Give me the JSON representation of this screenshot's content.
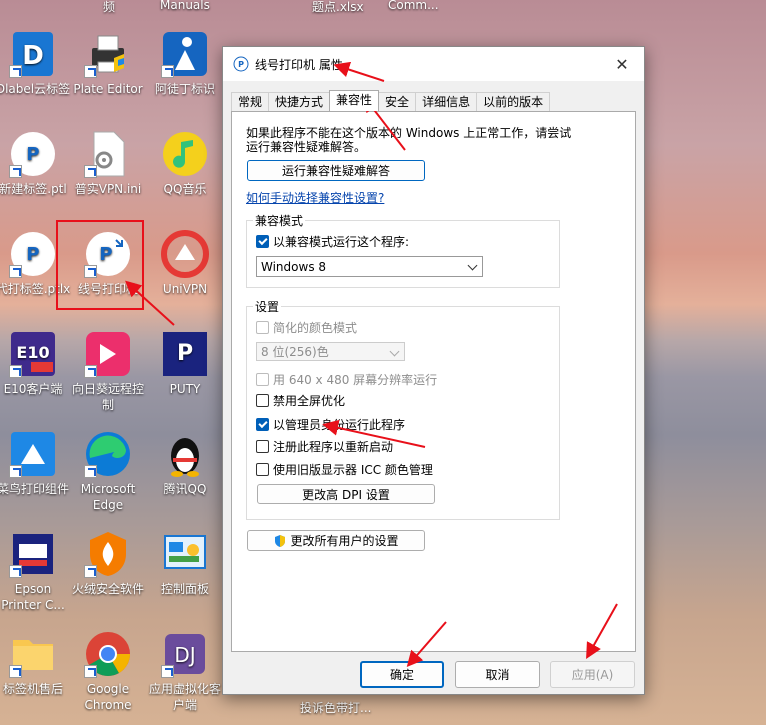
{
  "desktop": {
    "top_captions": [
      "频",
      "Manuals",
      "题点.xlsx",
      "Comm..."
    ],
    "icons": [
      {
        "label": "Dlabel云标签",
        "icon": "dlabel-app-icon"
      },
      {
        "label": "Plate Editor",
        "icon": "printer-app-icon"
      },
      {
        "label": "阿徒丁标识",
        "icon": "atu-app-icon"
      },
      {
        "label": "新建标签.ptl",
        "icon": "puty-file-icon"
      },
      {
        "label": "普实VPN.ini",
        "icon": "settings-file-icon"
      },
      {
        "label": "QQ音乐",
        "icon": "qq-music-icon"
      },
      {
        "label": "代打标签.ptlx",
        "icon": "puty-file-icon"
      },
      {
        "label": "线号打印机",
        "icon": "puty-app-icon"
      },
      {
        "label": "UniVPN",
        "icon": "univpn-icon"
      },
      {
        "label": "E10客户端",
        "icon": "e10-app-icon"
      },
      {
        "label": "向日葵远程控制",
        "icon": "sunlogin-icon"
      },
      {
        "label": "PUTY",
        "icon": "puty-logo-icon"
      },
      {
        "label": "菜鸟打印组件",
        "icon": "cainiao-icon"
      },
      {
        "label": "Microsoft Edge",
        "icon": "edge-icon"
      },
      {
        "label": "腾讯QQ",
        "icon": "qq-penguin-icon"
      },
      {
        "label": "Epson Printer C...",
        "icon": "epson-icon"
      },
      {
        "label": "火绒安全软件",
        "icon": "huorong-icon"
      },
      {
        "label": "控制面板",
        "icon": "control-panel-icon"
      },
      {
        "label": "标签机售后",
        "icon": "folder-icon"
      },
      {
        "label": "Google Chrome",
        "icon": "chrome-icon"
      },
      {
        "label": "应用虚拟化客户端",
        "icon": "virtual-app-icon"
      }
    ],
    "bottom_caption": "投诉色带打..."
  },
  "dialog": {
    "title": "线号打印机 属性",
    "close_glyph": "✕",
    "tabs": [
      "常规",
      "快捷方式",
      "兼容性",
      "安全",
      "详细信息",
      "以前的版本"
    ],
    "active_tab": 2,
    "intro_line1": "如果此程序不能在这个版本的 Windows 上正常工作，请尝试",
    "intro_line2": "运行兼容性疑难解答。",
    "troubleshoot_button": "运行兼容性疑难解答",
    "manual_link": "如何手动选择兼容性设置?",
    "compat_group_label": "兼容模式",
    "compat_checkbox": "以兼容模式运行这个程序:",
    "compat_os": "Windows 8",
    "settings_group_label": "设置",
    "reduced_color": "简化的颜色模式",
    "color_depth": "8 位(256)色",
    "res_640": "用 640 x 480 屏幕分辨率运行",
    "disable_fullscreen": "禁用全屏优化",
    "run_as_admin": "以管理员身份运行此程序",
    "register_restart": "注册此程序以重新启动",
    "legacy_icc": "使用旧版显示器 ICC 颜色管理",
    "dpi_button": "更改高 DPI 设置",
    "all_users_button": "更改所有用户的设置",
    "ok_button": "确定",
    "cancel_button": "取消",
    "apply_button": "应用(A)"
  },
  "colors": {
    "accent": "#005fb8",
    "arrow": "#e8101a",
    "highlight_box": "#e8101a"
  }
}
